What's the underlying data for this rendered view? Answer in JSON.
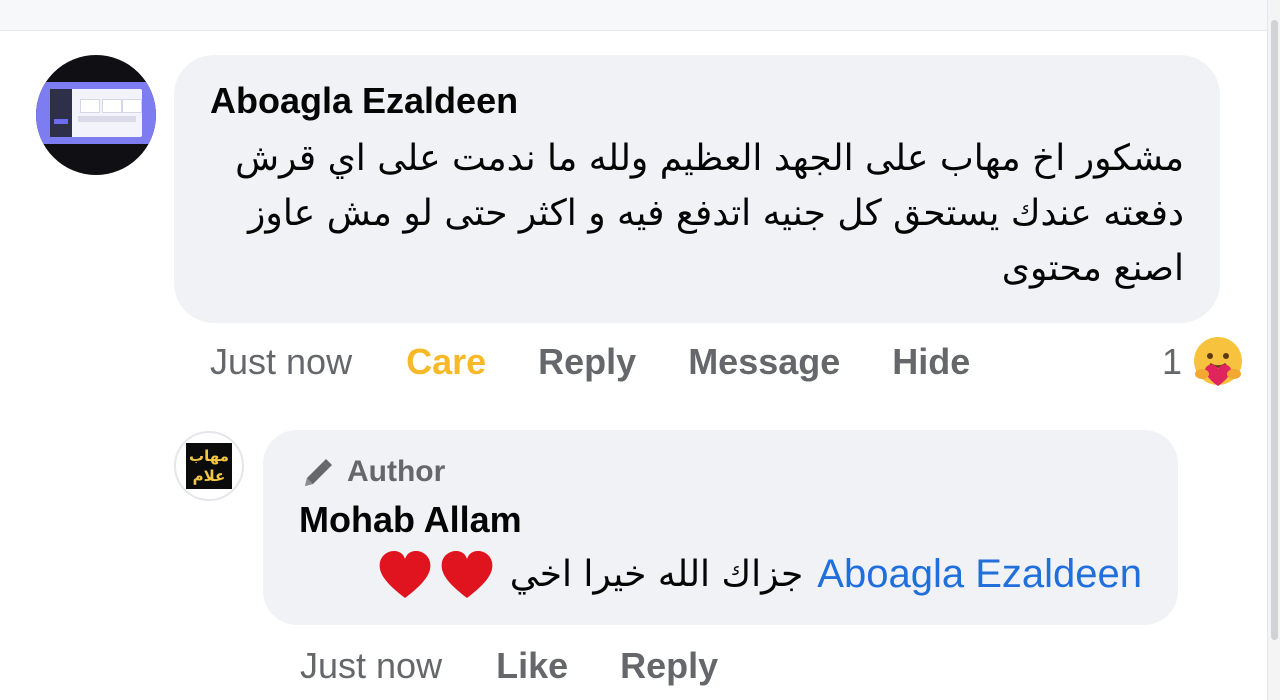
{
  "comment": {
    "author_name": "Aboagla Ezaldeen",
    "text": "مشكور اخ مهاب على الجهد العظيم ولله ما ندمت على اي قرش دفعته عندك يستحق كل جنيه اتدفع فيه و اكثر حتى لو مش عاوز اصنع محتوى",
    "time": "Just now",
    "actions": {
      "react_label": "Care",
      "reply": "Reply",
      "message": "Message",
      "hide": "Hide"
    },
    "reaction_count": "1",
    "reaction_icon": "care-emoji-icon",
    "react_color": "#f7b928"
  },
  "reply": {
    "badge_label": "Author",
    "badge_icon": "pen-icon",
    "avatar_text": "مهاب علام",
    "author_name": "Mohab Allam",
    "mention": "Aboagla Ezaldeen",
    "text": "جزاك الله خيرا اخي",
    "emoji_icons": [
      "heart-icon",
      "heart-icon"
    ],
    "time": "Just now",
    "actions": {
      "like": "Like",
      "reply": "Reply"
    },
    "mention_color": "#216fdb"
  },
  "colors": {
    "bubble": "#f0f2f5",
    "meta_text": "#65676b",
    "heart": "#e0141e"
  }
}
